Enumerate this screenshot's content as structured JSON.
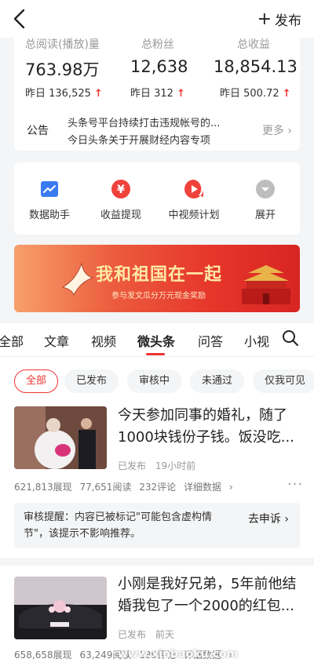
{
  "header": {
    "publish_label": "发布"
  },
  "stats": {
    "reads": {
      "label": "总阅读(播放)量",
      "value": "763.98万",
      "yesterday": "昨日 136,525"
    },
    "fans": {
      "label": "总粉丝",
      "value": "12,638",
      "yesterday": "昨日 312"
    },
    "income": {
      "label": "总收益",
      "value": "18,854.13",
      "yesterday": "昨日 500.72"
    }
  },
  "notice": {
    "tag": "公告",
    "line1": "头条号平台持续打击违规帐号的...",
    "line2": "今日头条关于开展财经内容专项",
    "more": "更多"
  },
  "tools": [
    {
      "label": "数据助手",
      "icon": "chart-icon"
    },
    {
      "label": "收益提现",
      "icon": "yuan-icon"
    },
    {
      "label": "中视频计划",
      "icon": "video-icon"
    },
    {
      "label": "展开",
      "icon": "expand-icon"
    }
  ],
  "banner": {
    "title": "我和祖国在一起",
    "subtitle": "参与发文瓜分万元现金奖励"
  },
  "tabs": [
    "全部",
    "文章",
    "视频",
    "微头条",
    "问答",
    "小视"
  ],
  "active_tab": "微头条",
  "filters": [
    "全部",
    "已发布",
    "审核中",
    "未通过",
    "仅我可见"
  ],
  "active_filter": "全部",
  "articles": [
    {
      "title": "今天参加同事的婚礼，随了1000块钱份子钱。饭没吃...",
      "status": "已发布",
      "time": "19小时前",
      "impressions": "621,813展现",
      "reads": "77,651阅读",
      "comments": "232评论",
      "detail": "详细数据"
    },
    {
      "title": "小刚是我好兄弟，5年前他结婚我包了一个2000的红包...",
      "status": "已发布",
      "time": "前天",
      "impressions": "658,658展现",
      "reads": "63,249阅读",
      "comments": "189评论",
      "detail": "详细数据"
    }
  ],
  "review_notice": {
    "text": "审核提醒：内容已被标记\"可能包含虚构情节\"，该提示不影响推荐。",
    "appeal": "去申诉"
  },
  "watermark": "www.xinbaoku.com",
  "colors": {
    "accent": "#e33333",
    "banner_text": "#ffe9a6",
    "tool_blue": "#3a7bf0",
    "tool_red": "#f0413b",
    "tool_gray": "#bdbdbd"
  }
}
